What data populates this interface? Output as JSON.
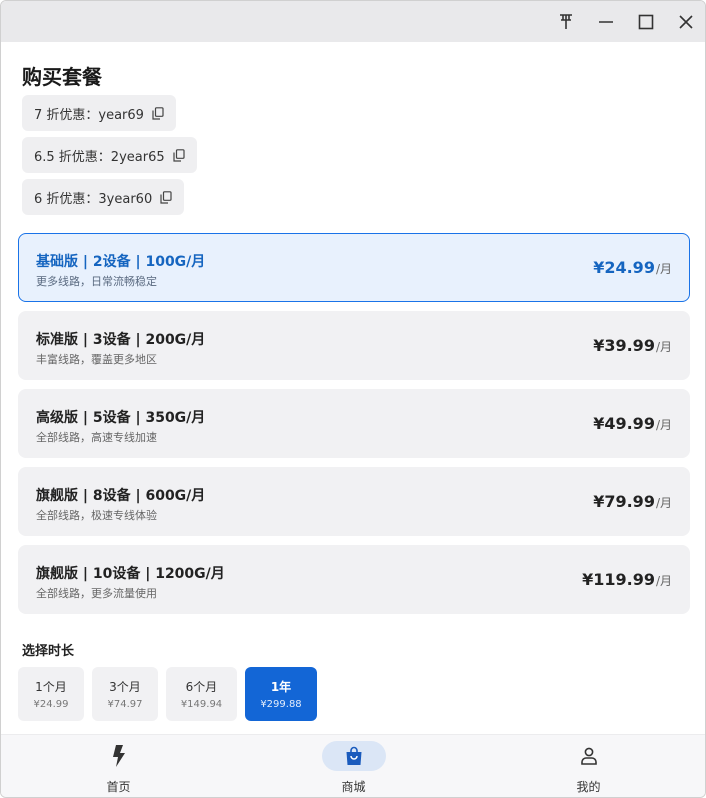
{
  "page": {
    "title": "购买套餐"
  },
  "coupons": [
    {
      "text": "7 折优惠：year69"
    },
    {
      "text": "6.5 折优惠：2year65"
    },
    {
      "text": "6 折优惠：3year60"
    }
  ],
  "plans": [
    {
      "name": "基础版 | 2设备 | 100G/月",
      "desc": "更多线路，日常流畅稳定",
      "price": "¥24.99",
      "unit": "/月",
      "selected": true
    },
    {
      "name": "标准版 | 3设备 | 200G/月",
      "desc": "丰富线路，覆盖更多地区",
      "price": "¥39.99",
      "unit": "/月",
      "selected": false
    },
    {
      "name": "高级版 | 5设备 | 350G/月",
      "desc": "全部线路，高速专线加速",
      "price": "¥49.99",
      "unit": "/月",
      "selected": false
    },
    {
      "name": "旗舰版 | 8设备 | 600G/月",
      "desc": "全部线路，极速专线体验",
      "price": "¥79.99",
      "unit": "/月",
      "selected": false
    },
    {
      "name": "旗舰版 | 10设备 | 1200G/月",
      "desc": "全部线路，更多流量使用",
      "price": "¥119.99",
      "unit": "/月",
      "selected": false
    }
  ],
  "duration": {
    "label": "选择时长",
    "options": [
      {
        "label": "1个月",
        "price": "¥24.99",
        "active": false
      },
      {
        "label": "3个月",
        "price": "¥74.97",
        "active": false
      },
      {
        "label": "6个月",
        "price": "¥149.94",
        "active": false
      },
      {
        "label": "1年",
        "price": "¥299.88",
        "active": true
      }
    ]
  },
  "nav": {
    "items": [
      {
        "label": "首页",
        "icon": "lightning-icon",
        "active": false
      },
      {
        "label": "商城",
        "icon": "shopping-bag-icon",
        "active": true
      },
      {
        "label": "我的",
        "icon": "person-icon",
        "active": false
      }
    ]
  },
  "colors": {
    "accent": "#1366d6",
    "selected_bg": "#e8f1fd",
    "card_bg": "#f1f1f3"
  }
}
